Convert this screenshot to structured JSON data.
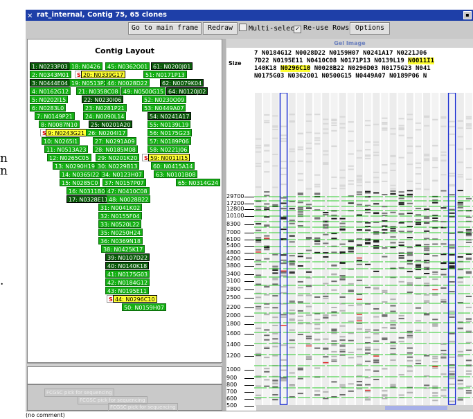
{
  "outer_fragments": [
    "n",
    "n",
    "."
  ],
  "window": {
    "title": "rat_internal, Contig 75, 65 clones",
    "close_glyph": "▪"
  },
  "toolbar": {
    "main_frame": "Go to main frame",
    "redraw": "Redraw",
    "multi_select": "Multi-select",
    "multi_select_checked": false,
    "reuse_rows": "Re-use Rows",
    "reuse_rows_checked": true,
    "options": "Options"
  },
  "contig_layout": {
    "title": "Contig Layout",
    "clones": [
      {
        "label": "1: N0233P03",
        "style": "dark"
      },
      {
        "label": "18: N0426",
        "style": "normal"
      },
      {
        "label": "45: N0362O01",
        "style": "normal"
      },
      {
        "label": "61: N0200J01",
        "style": "dark"
      },
      {
        "label": "2: N0343M01",
        "style": "normal"
      },
      {
        "label": "S",
        "style": "s"
      },
      {
        "label": "20: N0339G17",
        "style": "yellow"
      },
      {
        "label": "51: N0171P13",
        "style": "normal"
      },
      {
        "label": "3: N0444E04",
        "style": "dark"
      },
      {
        "label": "19: N0513P22",
        "style": "normal"
      },
      {
        "label": "46: N0028D22",
        "style": "normal"
      },
      {
        "label": "62: N0079K04",
        "style": "dark"
      },
      {
        "label": "4: N0162G12",
        "style": "normal"
      },
      {
        "label": "21: N0358C08",
        "style": "normal"
      },
      {
        "label": "49: N0500G15",
        "style": "normal"
      },
      {
        "label": "64: N0120J02",
        "style": "dark"
      },
      {
        "label": "5: N0202I15",
        "style": "normal"
      },
      {
        "label": "22: N0230I06",
        "style": "dark"
      },
      {
        "label": "52: N0230O09",
        "style": "normal"
      },
      {
        "label": "6: N0283L0",
        "style": "normal"
      },
      {
        "label": "23: N0281P21",
        "style": "normal"
      },
      {
        "label": "53: N0449A07",
        "style": "normal"
      },
      {
        "label": "7: N0149P21",
        "style": "normal"
      },
      {
        "label": "24: N0090L14",
        "style": "normal"
      },
      {
        "label": "54: N0241A17",
        "style": "dark"
      },
      {
        "label": "8: N0087N10",
        "style": "normal"
      },
      {
        "label": "25: N0201A20",
        "style": "dark"
      },
      {
        "label": "55: N0139L19",
        "style": "normal"
      },
      {
        "label": "S",
        "style": "s"
      },
      {
        "label": "9: N0243G21",
        "style": "yellow"
      },
      {
        "label": "26: N0204I17",
        "style": "normal"
      },
      {
        "label": "56: N0175G23",
        "style": "normal"
      },
      {
        "label": "10: N0265I1",
        "style": "normal"
      },
      {
        "label": "27: N0291A09",
        "style": "normal"
      },
      {
        "label": "57: N0189P06",
        "style": "normal"
      },
      {
        "label": "11: N0513A23",
        "style": "normal"
      },
      {
        "label": "28: N0185M08",
        "style": "normal"
      },
      {
        "label": "58: N0221J06",
        "style": "normal"
      },
      {
        "label": "12: N0265C05",
        "style": "normal"
      },
      {
        "label": "29: N0201K20",
        "style": "normal"
      },
      {
        "label": "S",
        "style": "s"
      },
      {
        "label": "59: N0011I15",
        "style": "yellow"
      },
      {
        "label": "13: N0290H19",
        "style": "normal"
      },
      {
        "label": "30: N0229B13",
        "style": "normal"
      },
      {
        "label": "60: N0415A14",
        "style": "normal"
      },
      {
        "label": "14: N0365I22",
        "style": "normal"
      },
      {
        "label": "34: N0123H07",
        "style": "normal"
      },
      {
        "label": "63: N0101B08",
        "style": "normal"
      },
      {
        "label": "15: N0285C0",
        "style": "normal"
      },
      {
        "label": "37: N0157P07",
        "style": "normal"
      },
      {
        "label": "65: N0314G24",
        "style": "normal"
      },
      {
        "label": "16: N0311B04",
        "style": "normal"
      },
      {
        "label": "47: N0410C08",
        "style": "normal"
      },
      {
        "label": "17: N0328E11",
        "style": "dark"
      },
      {
        "label": "48: N0028B22",
        "style": "normal"
      },
      {
        "label": "31: N0041K02",
        "style": "normal"
      },
      {
        "label": "32: N0155F04",
        "style": "normal"
      },
      {
        "label": "33: N0520L22",
        "style": "normal"
      },
      {
        "label": "35: N0250H24",
        "style": "normal"
      },
      {
        "label": "36: N0369N18",
        "style": "normal"
      },
      {
        "label": "38: N0425K17",
        "style": "normal"
      },
      {
        "label": "39: N0107D22",
        "style": "dark"
      },
      {
        "label": "40: N0140K18",
        "style": "dark"
      },
      {
        "label": "41: N0175G03",
        "style": "normal"
      },
      {
        "label": "42: N0184G12",
        "style": "normal"
      },
      {
        "label": "43: N0195E11",
        "style": "normal"
      },
      {
        "label": "S",
        "style": "s"
      },
      {
        "label": "44: N0296C10",
        "style": "yellow"
      },
      {
        "label": "50: N0159H07",
        "style": "normal"
      }
    ],
    "sequencing_picks": [
      "FCGSC pick for sequencing",
      "FCGSC pick for sequencing",
      "FCGSC pick for sequencing"
    ]
  },
  "status": {
    "comment": "(no comment)"
  },
  "gel": {
    "title": "Gel Image",
    "size_label": "Size",
    "clone_rows": [
      [
        {
          "t": "7  N0184G12  N0028D22  N0159H07  N0241A17  N0221J06 "
        }
      ],
      [
        {
          "t": "7D22  N0195E11  N0410C08  N0171P13  N0139L19  "
        },
        {
          "t": "N0011I1",
          "hl": true
        }
      ],
      [
        {
          "t": "140K18  "
        },
        {
          "t": "N0296C10",
          "hl": true
        },
        {
          "t": "  N0028B22  N0296D03  N0175G23  N041"
        }
      ],
      [
        {
          "t": "N0175G03  N0362O01  N0500G15  N0449A07  N0189P06  N"
        }
      ]
    ],
    "size_ticks": [
      "29700",
      "17200",
      "12800",
      "10100",
      "8300",
      "7000",
      "6100",
      "5400",
      "4800",
      "4200",
      "3800",
      "3400",
      "3100",
      "2800",
      "2500",
      "2200",
      "2000",
      "1800",
      "1600",
      "1400",
      "1200",
      "1000",
      "900",
      "800",
      "700",
      "600",
      "500"
    ],
    "lane_count": 26,
    "highlighted_lanes": [
      3,
      23
    ]
  }
}
